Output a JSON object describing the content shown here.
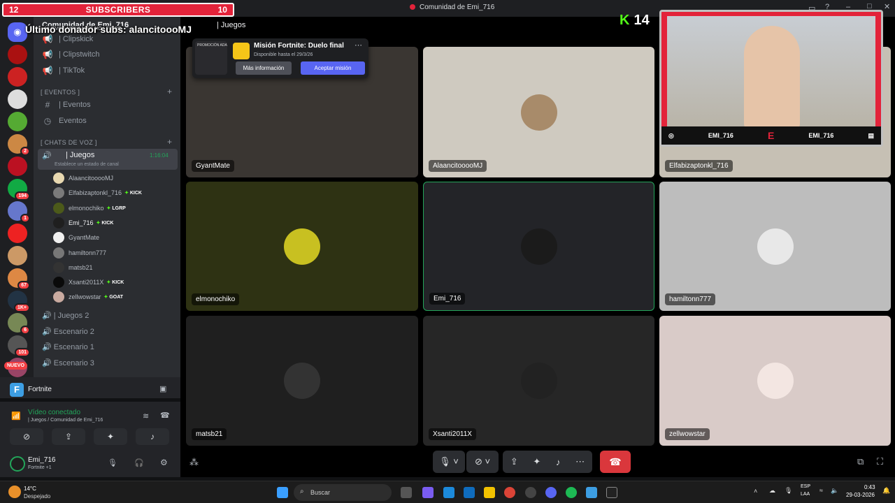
{
  "window": {
    "title": "Comunidad de Emi_716"
  },
  "subscribers": {
    "left": "12",
    "label": "SUBSCRIBERS",
    "right": "10"
  },
  "donor_text": "Último donador subs: alancitoooMJ",
  "kick_count": "14",
  "server": {
    "name": "Comunidad de Emi_716"
  },
  "unread_pill": "NUEVOS MENSAJES NO LEÍDOS",
  "rail_badges": [
    "2",
    "194",
    "1",
    "67",
    "1K+",
    "6",
    "101"
  ],
  "rail_new": "NUEVO",
  "channels": {
    "top": [
      "| Clipskick",
      "| Clipstwitch",
      "| TikTok"
    ],
    "events_cat": "[ EVENTOS ]",
    "events": [
      "| Eventos",
      "Eventos"
    ],
    "voice_cat": "[ CHATS DE VOZ ]",
    "active": {
      "name": "| Juegos",
      "time": "1:16:04",
      "status": "Establece un estado de canal"
    },
    "voice_users": [
      {
        "name": "AlaancitooooMJ",
        "tag": ""
      },
      {
        "name": "Elfabizaptonkl_716",
        "tag": "KICK"
      },
      {
        "name": "elmonochiko",
        "tag": "LGRP"
      },
      {
        "name": "Emi_716",
        "tag": "KICK"
      },
      {
        "name": "GyantMate",
        "tag": ""
      },
      {
        "name": "hamiltonn777",
        "tag": ""
      },
      {
        "name": "matsb21",
        "tag": ""
      },
      {
        "name": "Xsanti2011X",
        "tag": "KICK"
      },
      {
        "name": "zellwowstar",
        "tag": "GOAT"
      }
    ],
    "other_voice": [
      "| Juegos 2",
      "Escenario 2",
      "Escenario 1",
      "Escenario 3"
    ]
  },
  "activity": {
    "name": "Fortnite"
  },
  "rtc": {
    "status": "Vídeo conectado",
    "channel": "| Juegos / Comunidad de Emi_716"
  },
  "user": {
    "name": "Emi_716",
    "status": "Fortnite +1"
  },
  "call": {
    "channel": "| Juegos"
  },
  "mission": {
    "badge": "PROMOCIÓN ADA",
    "title": "Misión Fortnite: Duelo final",
    "subtitle": "Disponible hasta el 29/3/26",
    "more": "Más información",
    "accept": "Aceptar misión"
  },
  "tiles": [
    {
      "name": "GyantMate",
      "bg": "#3a3632"
    },
    {
      "name": "AlaancitooooMJ",
      "bg": "#cfcac0"
    },
    {
      "name": "Elfabizaptonkl_716",
      "bg": "#c6c0b4"
    },
    {
      "name": "elmonochiko",
      "bg": "#2e3213"
    },
    {
      "name": "Emi_716",
      "bg": "#232428"
    },
    {
      "name": "hamiltonn777",
      "bg": "#bdbdbd"
    },
    {
      "name": "matsb21",
      "bg": "#1f1f1f"
    },
    {
      "name": "Xsanti2011X",
      "bg": "#262626"
    },
    {
      "name": "zellwowstar",
      "bg": "#d9cbc8"
    }
  ],
  "cam": {
    "left_handle": "EMI_716",
    "right_handle": "EMI_716"
  },
  "taskbar": {
    "weather_temp": "14°C",
    "weather_desc": "Despejado",
    "search": "Buscar",
    "lang1": "ESP",
    "lang2": "LAA",
    "time": "0:43",
    "date": "29-03-2026"
  }
}
